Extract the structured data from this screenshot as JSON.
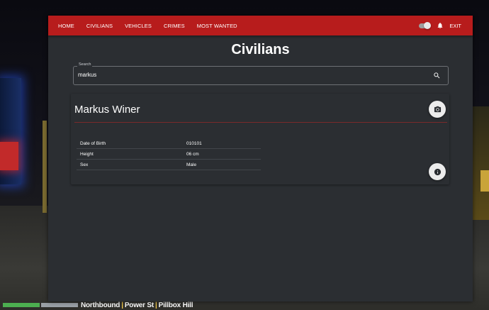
{
  "nav": {
    "items": [
      {
        "label": "HOME"
      },
      {
        "label": "CIVILIANS"
      },
      {
        "label": "VEHICLES"
      },
      {
        "label": "CRIMES"
      },
      {
        "label": "MOST WANTED"
      }
    ],
    "exit_label": "EXIT",
    "toggle_state": "on"
  },
  "page": {
    "title": "Civilians"
  },
  "search": {
    "label": "Search",
    "value": "markus"
  },
  "result": {
    "name": "Markus Winer",
    "fields": [
      {
        "label": "Date of Birth",
        "value": "010101"
      },
      {
        "label": "Height",
        "value": "06 cm"
      },
      {
        "label": "Sex",
        "value": "Male"
      }
    ]
  },
  "hud": {
    "location_parts": [
      "Northbound",
      "Power St",
      "Pillbox Hill"
    ]
  },
  "colors": {
    "navbar": "#b71c1c",
    "panel": "#2b2e32",
    "divider": "#7a2a2a"
  }
}
